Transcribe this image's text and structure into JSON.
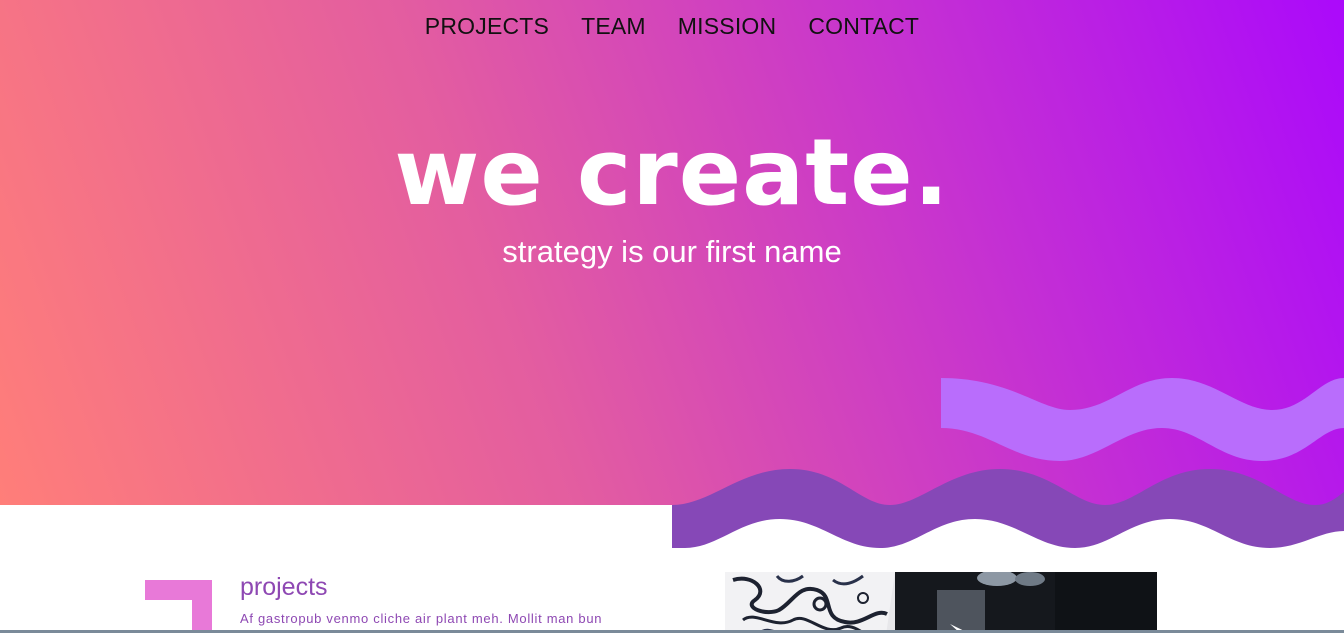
{
  "nav": {
    "items": [
      {
        "label": "PROJECTS"
      },
      {
        "label": "TEAM"
      },
      {
        "label": "MISSION"
      },
      {
        "label": "CONTACT"
      }
    ]
  },
  "hero": {
    "title": "we create.",
    "subtitle": "strategy is our first name"
  },
  "projects": {
    "heading": "projects",
    "text": "Af gastropub venmo cliche air plant meh. Mollit man bun"
  },
  "colors": {
    "gradient_start": "#ff7e79",
    "gradient_end": "#ab09fb",
    "wave_light": "#b96dfc",
    "wave_dark": "#8648b7",
    "accent_purple": "#8e48b3",
    "bracket_pink": "#e879d8"
  }
}
